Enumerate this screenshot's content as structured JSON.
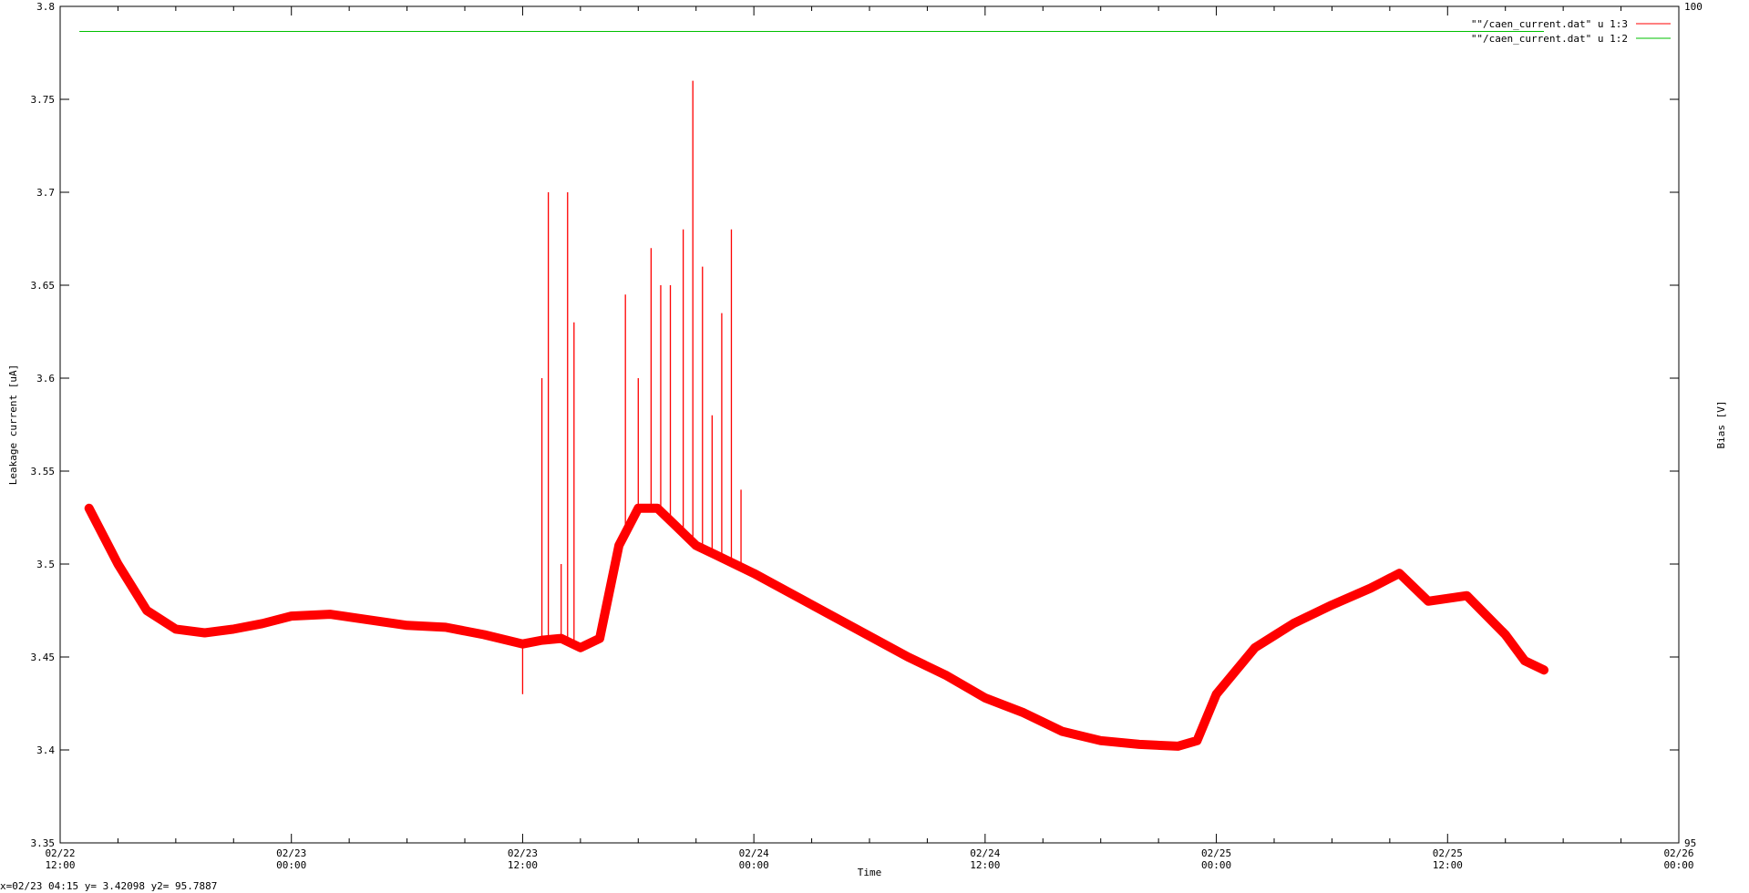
{
  "status_bar": {
    "readout": "x=02/23 04:15 y= 3.42098 y2= 95.7887"
  },
  "colors": {
    "series_current": "#ff0000",
    "series_bias": "#00c000",
    "axes": "#000000",
    "background": "#ffffff"
  },
  "chart_data": {
    "type": "line",
    "title": "",
    "xlabel": "Time",
    "ylabel": "Leakage current [uA]",
    "y2label": "Bias [V]",
    "xlim": [
      "02/22 12:00",
      "02/26 00:00"
    ],
    "ylim": [
      3.35,
      3.8
    ],
    "y2lim": [
      95,
      100
    ],
    "grid": false,
    "legend_position": "top-right",
    "x_ticks": [
      {
        "date": "02/22",
        "time": "12:00"
      },
      {
        "date": "02/23",
        "time": "00:00"
      },
      {
        "date": "02/23",
        "time": "12:00"
      },
      {
        "date": "02/24",
        "time": "00:00"
      },
      {
        "date": "02/24",
        "time": "12:00"
      },
      {
        "date": "02/25",
        "time": "00:00"
      },
      {
        "date": "02/25",
        "time": "12:00"
      },
      {
        "date": "02/26",
        "time": "00:00"
      }
    ],
    "y_ticks": [
      "3.35",
      "3.4",
      "3.45",
      "3.5",
      "3.55",
      "3.6",
      "3.65",
      "3.7",
      "3.75",
      "3.8"
    ],
    "y2_ticks": [
      "95",
      "100"
    ],
    "series": [
      {
        "name": "\"\"/caen_current.dat\" u 1:3",
        "axis": "y",
        "color": "#ff0000",
        "x": [
          "02/22 13:30",
          "02/22 15:00",
          "02/22 16:30",
          "02/22 18:00",
          "02/22 19:30",
          "02/22 21:00",
          "02/22 22:30",
          "02/23 00:00",
          "02/23 02:00",
          "02/23 04:00",
          "02/23 06:00",
          "02/23 08:00",
          "02/23 10:00",
          "02/23 12:00",
          "02/23 13:00",
          "02/23 14:00",
          "02/23 15:00",
          "02/23 16:00",
          "02/23 17:00",
          "02/23 18:00",
          "02/23 19:00",
          "02/23 20:00",
          "02/23 21:00",
          "02/23 22:00",
          "02/23 23:00",
          "02/24 00:00",
          "02/24 08:00",
          "02/24 10:00",
          "02/24 12:00",
          "02/24 14:00",
          "02/24 16:00",
          "02/24 18:00",
          "02/24 20:00",
          "02/24 22:00",
          "02/24 23:00",
          "02/25 00:00",
          "02/25 02:00",
          "02/25 04:00",
          "02/25 06:00",
          "02/25 08:00",
          "02/25 09:30",
          "02/25 11:00",
          "02/25 13:00",
          "02/25 15:00",
          "02/25 16:00",
          "02/25 17:00"
        ],
        "values": [
          3.53,
          3.5,
          3.475,
          3.465,
          3.463,
          3.465,
          3.468,
          3.472,
          3.473,
          3.47,
          3.467,
          3.466,
          3.462,
          3.457,
          3.459,
          3.46,
          3.455,
          3.46,
          3.51,
          3.53,
          3.53,
          3.52,
          3.51,
          3.505,
          3.5,
          3.495,
          3.45,
          3.44,
          3.428,
          3.42,
          3.41,
          3.405,
          3.403,
          3.402,
          3.405,
          3.43,
          3.455,
          3.468,
          3.478,
          3.487,
          3.495,
          3.48,
          3.483,
          3.462,
          3.448,
          3.443
        ]
      },
      {
        "name": "\"\"/caen_current.dat\" u 1:2",
        "axis": "y2",
        "color": "#00c000",
        "x": [
          "02/22 13:00",
          "02/25 17:00"
        ],
        "values": [
          99.85,
          99.85
        ]
      }
    ],
    "spikes": [
      {
        "x": "02/23 12:00",
        "y": 3.43
      },
      {
        "x": "02/23 13:00",
        "y": 3.6
      },
      {
        "x": "02/23 13:20",
        "y": 3.7
      },
      {
        "x": "02/23 14:00",
        "y": 3.5
      },
      {
        "x": "02/23 14:20",
        "y": 3.7
      },
      {
        "x": "02/23 14:40",
        "y": 3.63
      },
      {
        "x": "02/23 17:20",
        "y": 3.645
      },
      {
        "x": "02/23 18:00",
        "y": 3.6
      },
      {
        "x": "02/23 18:40",
        "y": 3.67
      },
      {
        "x": "02/23 19:10",
        "y": 3.65
      },
      {
        "x": "02/23 19:40",
        "y": 3.65
      },
      {
        "x": "02/23 20:20",
        "y": 3.68
      },
      {
        "x": "02/23 20:50",
        "y": 3.76
      },
      {
        "x": "02/23 21:20",
        "y": 3.66
      },
      {
        "x": "02/23 21:50",
        "y": 3.58
      },
      {
        "x": "02/23 22:20",
        "y": 3.635
      },
      {
        "x": "02/23 22:50",
        "y": 3.68
      },
      {
        "x": "02/23 23:20",
        "y": 3.54
      }
    ]
  }
}
